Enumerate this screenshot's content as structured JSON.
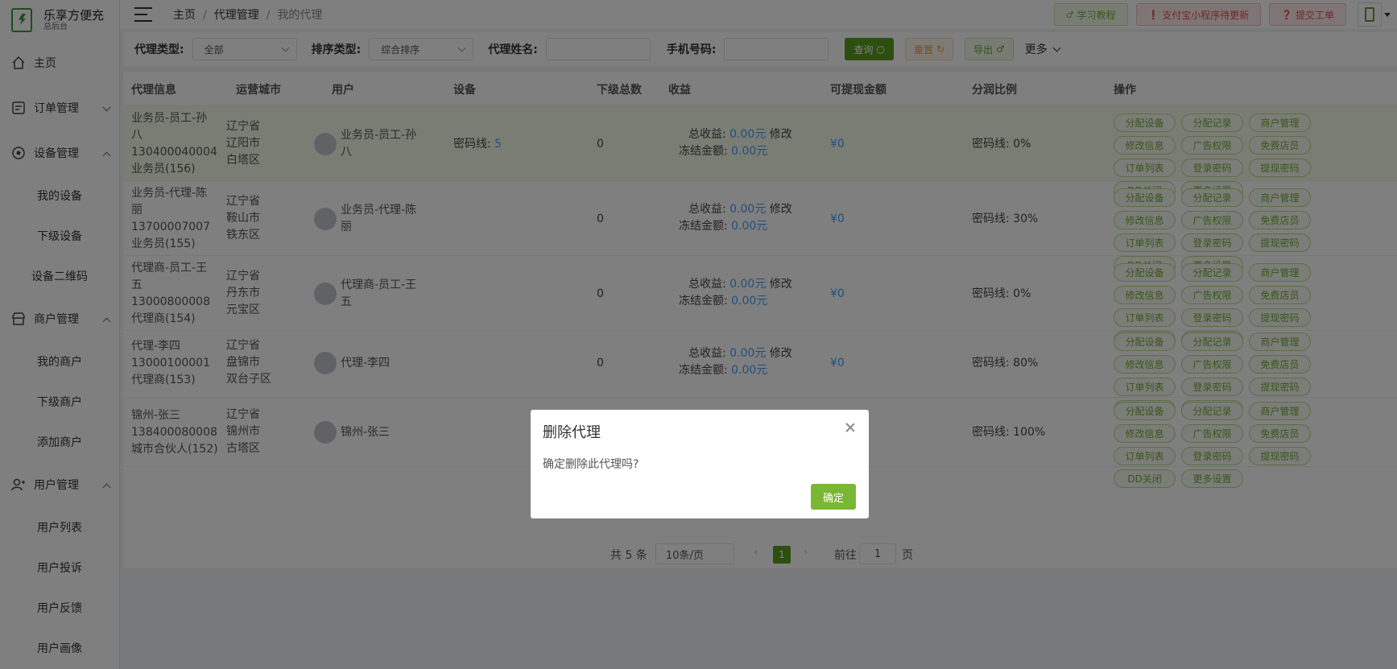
{
  "brand": {
    "name": "乐享方便充",
    "sub": "总后台"
  },
  "sidebar": {
    "items": [
      {
        "label": "主页"
      },
      {
        "label": "订单管理"
      },
      {
        "label": "设备管理",
        "children": [
          "我的设备",
          "下级设备",
          "设备二维码"
        ]
      },
      {
        "label": "商户管理",
        "children": [
          "我的商户",
          "下级商户",
          "添加商户"
        ]
      },
      {
        "label": "用户管理",
        "children": [
          "用户列表",
          "用户投诉",
          "用户反馈",
          "用户画像"
        ]
      }
    ]
  },
  "breadcrumb": [
    "主页",
    "代理管理",
    "我的代理"
  ],
  "topbar": {
    "learn": "学习教程",
    "alipay": "支付宝小程序待更新",
    "ticket": "提交工单"
  },
  "filters": {
    "agent_type_label": "代理类型:",
    "agent_type_value": "全部",
    "sort_label": "排序类型:",
    "sort_value": "综合排序",
    "name_label": "代理姓名:",
    "phone_label": "手机号码:",
    "search": "查询",
    "reset": "重置",
    "export": "导出",
    "more": "更多"
  },
  "table": {
    "headers": [
      "代理信息",
      "运营城市",
      "用户",
      "设备",
      "下级总数",
      "收益",
      "可提现金额",
      "分润比例",
      "操作"
    ],
    "labels": {
      "total_income": "总收益:",
      "frozen": "冻结金额:",
      "modify": "修改",
      "pw_line": "密码线:"
    },
    "ops": [
      "分配设备",
      "分配记录",
      "商户管理",
      "修改信息",
      "广告权限",
      "免费店员",
      "订单列表",
      "登录密码",
      "提现密码",
      "DD关闭",
      "更多设置"
    ],
    "rows": [
      {
        "info": [
          "业务员-员工-孙",
          "八",
          "130400040004",
          "业务员(156)"
        ],
        "city": [
          "辽宁省",
          "辽阳市",
          "白塔区"
        ],
        "user": [
          "业务员-员工-孙",
          "八"
        ],
        "device_label": "密码线:",
        "device_count": "5",
        "sub": "0",
        "income": "0.00元",
        "frozen": "0.00元",
        "withdraw": "¥0",
        "ratio": "密码线: 0%"
      },
      {
        "info": [
          "业务员-代理-陈",
          "丽",
          "13700007007",
          "业务员(155)"
        ],
        "city": [
          "辽宁省",
          "鞍山市",
          "铁东区"
        ],
        "user": [
          "业务员-代理-陈",
          "丽"
        ],
        "device_label": "",
        "device_count": "",
        "sub": "0",
        "income": "0.00元",
        "frozen": "0.00元",
        "withdraw": "¥0",
        "ratio": "密码线: 30%"
      },
      {
        "info": [
          "代理商-员工-王",
          "五",
          "13000800008",
          "代理商(154)"
        ],
        "city": [
          "辽宁省",
          "丹东市",
          "元宝区"
        ],
        "user": [
          "代理商-员工-王",
          "五"
        ],
        "device_label": "",
        "device_count": "",
        "sub": "0",
        "income": "0.00元",
        "frozen": "0.00元",
        "withdraw": "¥0",
        "ratio": "密码线: 0%"
      },
      {
        "info": [
          "代理-李四",
          "13000100001",
          "代理商(153)"
        ],
        "city": [
          "辽宁省",
          "盘锦市",
          "双台子区"
        ],
        "user": [
          "代理-李四"
        ],
        "device_label": "",
        "device_count": "",
        "sub": "0",
        "income": "0.00元",
        "frozen": "0.00元",
        "withdraw": "¥0",
        "ratio": "密码线: 80%"
      },
      {
        "info": [
          "锦州-张三",
          "138400080008",
          "城市合伙人(152)"
        ],
        "city": [
          "辽宁省",
          "锦州市",
          "古塔区"
        ],
        "user": [
          "锦州-张三"
        ],
        "device_label": "",
        "device_count": "",
        "sub": "",
        "income": "",
        "frozen": "",
        "withdraw": "",
        "ratio": "密码线: 100%"
      }
    ]
  },
  "pager": {
    "total": "共 5 条",
    "size": "10条/页",
    "page": "1",
    "goto": "前往",
    "goto_value": "1",
    "page_unit": "页"
  },
  "modal": {
    "title": "删除代理",
    "body": "确定删除此代理吗?",
    "confirm": "确定"
  }
}
